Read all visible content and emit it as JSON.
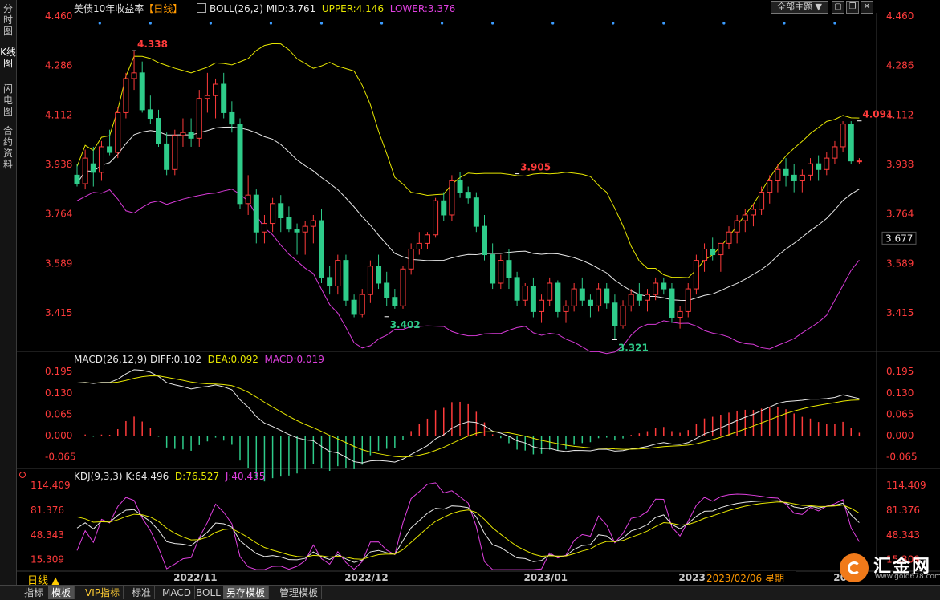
{
  "window": {
    "symbol": "美债10年收益率",
    "period_tag": "【日线】",
    "theme_button": "全部主题",
    "bottom_period": "日线 ▲",
    "bottom_tabs": [
      "指标",
      "模板",
      "VIP指标",
      "标准",
      "MACD",
      "BOLL",
      "另存模板",
      "管理模板"
    ],
    "left_tabs": [
      "分时图",
      "K线图",
      "闪电图",
      "合约资料"
    ],
    "date_tip": "2023/02/06 星期一",
    "logo_text": "汇金网",
    "logo_url": "www.gold678.com",
    "win_icons": [
      "max-icon",
      "restore-icon",
      "close-icon"
    ]
  },
  "indicators": {
    "boll": {
      "label": "BOLL(26,2)",
      "mid": "MID:3.761",
      "upper": "UPPER:4.146",
      "lower": "LOWER:3.376"
    },
    "macd": {
      "label": "MACD(26,12,9)",
      "diff": "DIFF:0.102",
      "dea": "DEA:0.092",
      "macd": "MACD:0.019"
    },
    "kdj": {
      "label": "KDJ(9,3,3)",
      "k": "K:64.496",
      "d": "D:76.527",
      "j": "J:40.435"
    }
  },
  "colors": {
    "up": "#ff3b3b",
    "down": "#2ecc8a",
    "boll_upper": "#e6e600",
    "boll_mid": "#e8e8e8",
    "boll_lower": "#d83ad8",
    "macd_diff": "#e8e8e8",
    "macd_dea": "#e6e600",
    "kdj_k": "#e8e8e8",
    "kdj_d": "#e6e600",
    "kdj_j": "#e040e0",
    "axis_text": "#ff3b3b"
  },
  "chart_data": [
    {
      "type": "candlestick",
      "y_ticks": [
        4.46,
        4.286,
        4.112,
        3.938,
        3.764,
        3.589,
        3.415
      ],
      "ylim": [
        3.28,
        4.46
      ],
      "x_tick_labels": [
        {
          "label": "2022/11",
          "i": 14
        },
        {
          "label": "2022/12",
          "i": 35
        },
        {
          "label": "2023/01",
          "i": 57
        },
        {
          "label": "2023/",
          "i": 76
        },
        {
          "label": "20",
          "i": 95
        }
      ],
      "current_price": "3.677",
      "annotations": [
        {
          "text": "4.338",
          "i": 7,
          "value": 4.338,
          "kind": "high"
        },
        {
          "text": "3.402",
          "i": 38,
          "value": 3.402,
          "kind": "low"
        },
        {
          "text": "3.905",
          "i": 54,
          "value": 3.905,
          "kind": "high"
        },
        {
          "text": "3.321",
          "i": 66,
          "value": 3.321,
          "kind": "low"
        },
        {
          "text": "4.091",
          "i": 96,
          "value": 4.091,
          "kind": "high"
        }
      ],
      "ohlc": [
        [
          3.9,
          3.94,
          3.86,
          3.87
        ],
        [
          3.87,
          3.99,
          3.85,
          3.96
        ],
        [
          3.94,
          4.0,
          3.86,
          3.91
        ],
        [
          3.91,
          4.02,
          3.88,
          4.0
        ],
        [
          4.0,
          4.06,
          3.97,
          3.98
        ],
        [
          3.98,
          4.14,
          3.96,
          4.12
        ],
        [
          4.12,
          4.26,
          4.1,
          4.24
        ],
        [
          4.24,
          4.34,
          4.2,
          4.26
        ],
        [
          4.26,
          4.3,
          4.12,
          4.13
        ],
        [
          4.13,
          4.18,
          4.08,
          4.1
        ],
        [
          4.1,
          4.13,
          4.0,
          4.01
        ],
        [
          4.01,
          4.05,
          3.9,
          3.92
        ],
        [
          3.92,
          4.06,
          3.9,
          4.04
        ],
        [
          4.04,
          4.1,
          4.0,
          4.05
        ],
        [
          4.05,
          4.1,
          4.0,
          4.03
        ],
        [
          4.03,
          4.2,
          4.0,
          4.17
        ],
        [
          4.17,
          4.26,
          4.12,
          4.18
        ],
        [
          4.18,
          4.24,
          4.1,
          4.22
        ],
        [
          4.22,
          4.26,
          4.1,
          4.12
        ],
        [
          4.12,
          4.16,
          4.05,
          4.08
        ],
        [
          4.08,
          4.1,
          3.78,
          3.8
        ],
        [
          3.8,
          3.9,
          3.76,
          3.83
        ],
        [
          3.83,
          3.85,
          3.66,
          3.7
        ],
        [
          3.7,
          3.76,
          3.66,
          3.73
        ],
        [
          3.73,
          3.82,
          3.7,
          3.8
        ],
        [
          3.8,
          3.83,
          3.7,
          3.75
        ],
        [
          3.75,
          3.79,
          3.7,
          3.71
        ],
        [
          3.71,
          3.73,
          3.62,
          3.7
        ],
        [
          3.7,
          3.74,
          3.62,
          3.72
        ],
        [
          3.72,
          3.76,
          3.66,
          3.74
        ],
        [
          3.74,
          3.78,
          3.52,
          3.54
        ],
        [
          3.54,
          3.58,
          3.48,
          3.51
        ],
        [
          3.51,
          3.62,
          3.48,
          3.6
        ],
        [
          3.6,
          3.62,
          3.44,
          3.46
        ],
        [
          3.46,
          3.48,
          3.4,
          3.41
        ],
        [
          3.41,
          3.5,
          3.4,
          3.48
        ],
        [
          3.48,
          3.6,
          3.45,
          3.58
        ],
        [
          3.58,
          3.62,
          3.5,
          3.52
        ],
        [
          3.52,
          3.56,
          3.44,
          3.47
        ],
        [
          3.47,
          3.5,
          3.43,
          3.44
        ],
        [
          3.44,
          3.58,
          3.43,
          3.57
        ],
        [
          3.57,
          3.66,
          3.55,
          3.64
        ],
        [
          3.64,
          3.7,
          3.62,
          3.66
        ],
        [
          3.66,
          3.7,
          3.64,
          3.69
        ],
        [
          3.69,
          3.82,
          3.68,
          3.81
        ],
        [
          3.81,
          3.84,
          3.74,
          3.76
        ],
        [
          3.76,
          3.9,
          3.74,
          3.88
        ],
        [
          3.88,
          3.91,
          3.82,
          3.84
        ],
        [
          3.84,
          3.86,
          3.8,
          3.82
        ],
        [
          3.82,
          3.84,
          3.7,
          3.72
        ],
        [
          3.72,
          3.76,
          3.6,
          3.62
        ],
        [
          3.62,
          3.66,
          3.5,
          3.52
        ],
        [
          3.52,
          3.62,
          3.5,
          3.6
        ],
        [
          3.6,
          3.64,
          3.5,
          3.54
        ],
        [
          3.54,
          3.56,
          3.44,
          3.46
        ],
        [
          3.46,
          3.52,
          3.44,
          3.51
        ],
        [
          3.51,
          3.54,
          3.4,
          3.42
        ],
        [
          3.42,
          3.48,
          3.38,
          3.46
        ],
        [
          3.46,
          3.54,
          3.44,
          3.52
        ],
        [
          3.52,
          3.53,
          3.4,
          3.42
        ],
        [
          3.42,
          3.46,
          3.38,
          3.44
        ],
        [
          3.44,
          3.52,
          3.42,
          3.5
        ],
        [
          3.5,
          3.54,
          3.44,
          3.46
        ],
        [
          3.46,
          3.48,
          3.4,
          3.44
        ],
        [
          3.44,
          3.52,
          3.42,
          3.5
        ],
        [
          3.5,
          3.52,
          3.43,
          3.45
        ],
        [
          3.45,
          3.48,
          3.32,
          3.37
        ],
        [
          3.37,
          3.46,
          3.36,
          3.44
        ],
        [
          3.44,
          3.5,
          3.42,
          3.48
        ],
        [
          3.48,
          3.52,
          3.44,
          3.46
        ],
        [
          3.46,
          3.5,
          3.42,
          3.48
        ],
        [
          3.48,
          3.54,
          3.46,
          3.52
        ],
        [
          3.52,
          3.54,
          3.48,
          3.5
        ],
        [
          3.5,
          3.52,
          3.38,
          3.4
        ],
        [
          3.4,
          3.44,
          3.36,
          3.42
        ],
        [
          3.42,
          3.52,
          3.4,
          3.5
        ],
        [
          3.5,
          3.62,
          3.48,
          3.6
        ],
        [
          3.6,
          3.66,
          3.56,
          3.64
        ],
        [
          3.64,
          3.68,
          3.6,
          3.62
        ],
        [
          3.62,
          3.66,
          3.56,
          3.66
        ],
        [
          3.66,
          3.72,
          3.64,
          3.7
        ],
        [
          3.7,
          3.76,
          3.66,
          3.74
        ],
        [
          3.74,
          3.78,
          3.7,
          3.76
        ],
        [
          3.76,
          3.8,
          3.72,
          3.78
        ],
        [
          3.78,
          3.86,
          3.76,
          3.84
        ],
        [
          3.84,
          3.9,
          3.8,
          3.88
        ],
        [
          3.88,
          3.94,
          3.84,
          3.92
        ],
        [
          3.92,
          3.96,
          3.86,
          3.9
        ],
        [
          3.9,
          3.94,
          3.84,
          3.88
        ],
        [
          3.88,
          3.92,
          3.84,
          3.9
        ],
        [
          3.9,
          3.96,
          3.88,
          3.94
        ],
        [
          3.94,
          3.97,
          3.88,
          3.92
        ],
        [
          3.92,
          3.98,
          3.9,
          3.96
        ],
        [
          3.96,
          4.02,
          3.94,
          4.0
        ],
        [
          4.0,
          4.09,
          3.98,
          4.08
        ],
        [
          4.08,
          4.09,
          3.94,
          3.95
        ],
        [
          3.95,
          3.96,
          3.94,
          3.95
        ]
      ]
    },
    {
      "type": "macd",
      "y_ticks": [
        0.195,
        0.13,
        0.065,
        0.0,
        -0.065
      ],
      "ylim": [
        -0.1,
        0.215
      ]
    },
    {
      "type": "kdj",
      "y_ticks": [
        114.409,
        81.376,
        48.343,
        15.309
      ],
      "ylim": [
        0,
        120
      ]
    }
  ]
}
